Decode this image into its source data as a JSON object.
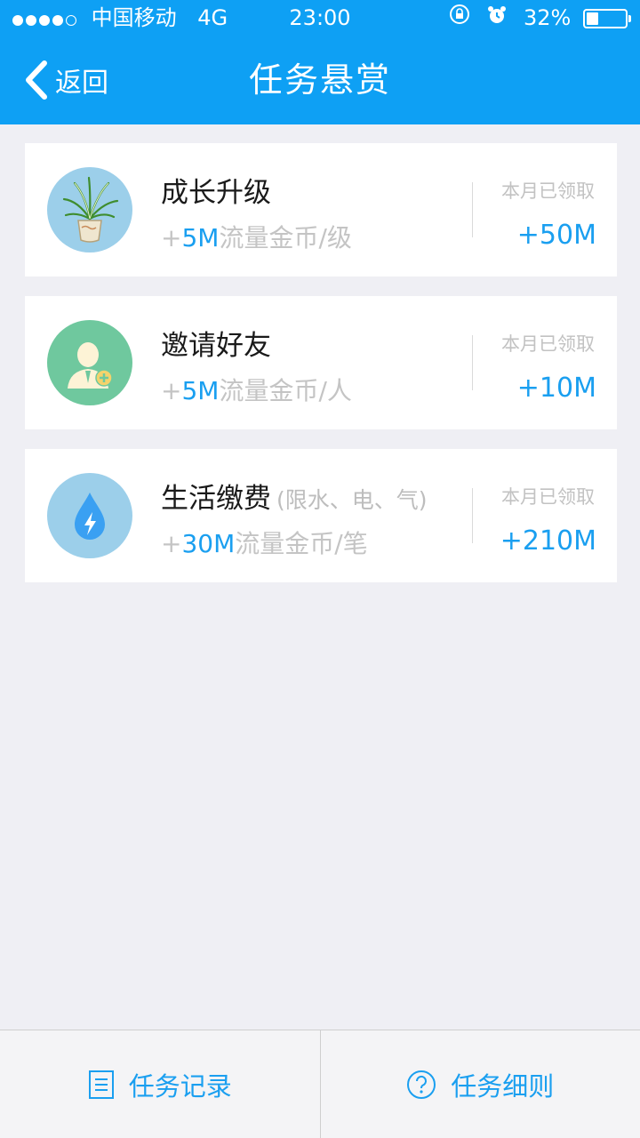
{
  "status_bar": {
    "carrier": "中国移动",
    "network": "4G",
    "time": "23:00",
    "battery_percent_text": "32%",
    "battery_level": 0.32
  },
  "nav": {
    "back_label": "返回",
    "title": "任务悬赏"
  },
  "tasks": [
    {
      "title": "成长升级",
      "note": "",
      "plus": "+",
      "amount": "5M",
      "unit": "流量金币/级",
      "month_label": "本月已领取",
      "month_value": "+50M",
      "icon": "plant-icon"
    },
    {
      "title": "邀请好友",
      "note": "",
      "plus": "+",
      "amount": "5M",
      "unit": "流量金币/人",
      "month_label": "本月已领取",
      "month_value": "+10M",
      "icon": "add-friend-icon"
    },
    {
      "title": "生活缴费",
      "note": "(限水、电、气)",
      "plus": "+",
      "amount": "30M",
      "unit": "流量金币/笔",
      "month_label": "本月已领取",
      "month_value": "+210M",
      "icon": "water-drop-icon"
    }
  ],
  "bottom": {
    "records_label": "任务记录",
    "rules_label": "任务细则"
  },
  "colors": {
    "accent": "#0ea0f4",
    "amount": "#1a9ff0",
    "background": "#efeff4",
    "avatar_plant": "#9ccfea",
    "avatar_friend": "#6fc89e",
    "avatar_drop": "#9ccfea"
  }
}
